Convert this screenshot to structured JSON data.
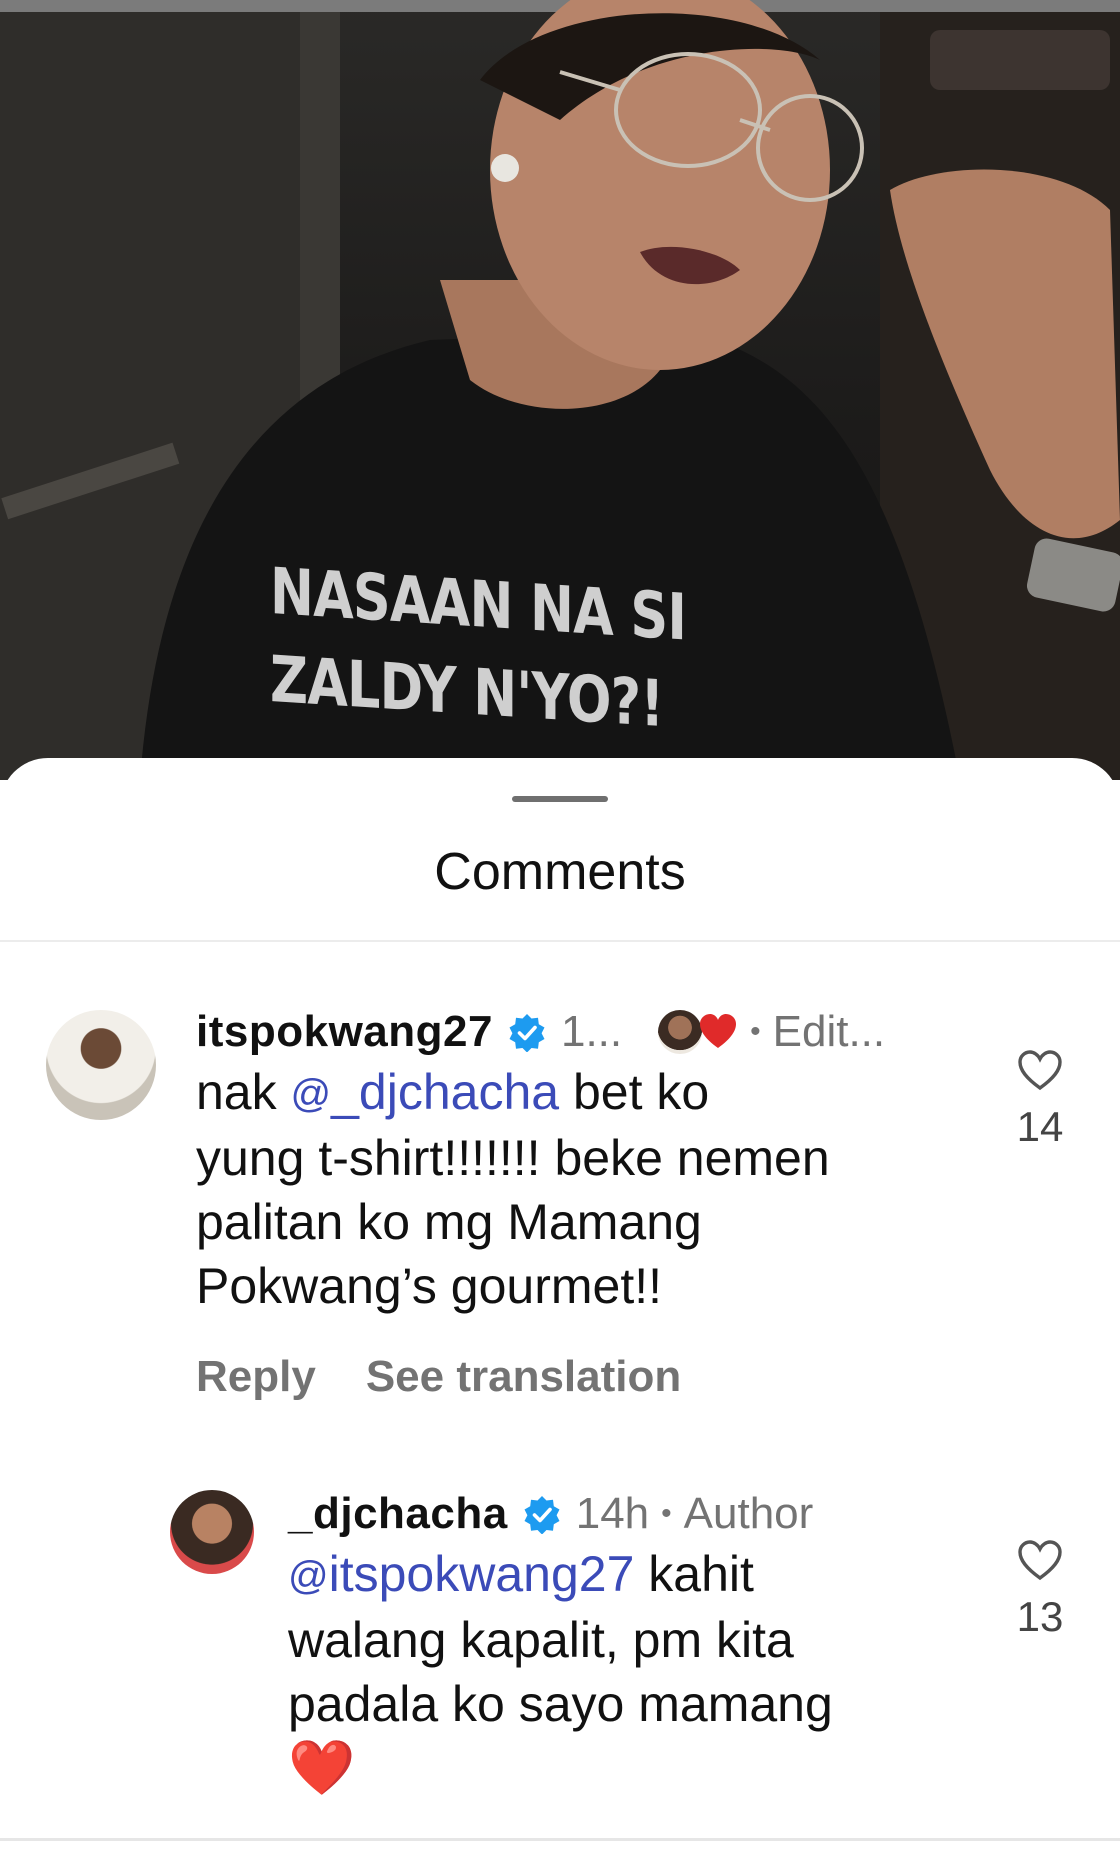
{
  "photo": {
    "shirt_line1": "NASAAN NA SI",
    "shirt_line2": "ZALDY N'YO?!"
  },
  "sheet": {
    "title": "Comments"
  },
  "comments": [
    {
      "username": "itspokwang27",
      "verified": true,
      "time": "1...",
      "author_liked": true,
      "edited": "Edit...",
      "mention": "_djchacha",
      "text_before_mention": "nak ",
      "text_after_mention": " bet ko\nyung t-shirt!!!!!!! beke nemen\npalitan ko mg Mamang\nPokwang’s gourmet!!",
      "actions": {
        "reply": "Reply",
        "see_translation": "See translation"
      },
      "likes": "14"
    },
    {
      "username": "_djchacha",
      "verified": true,
      "time": "14h",
      "badge": "Author",
      "mention": "itspokwang27",
      "text_after_mention": " kahit\nwalang kapalit, pm kita\npadala ko sayo mamang\n",
      "emoji": "❤️",
      "likes": "13"
    }
  ],
  "icons": {
    "verified": "verified-badge-icon",
    "like": "heart-outline-icon",
    "threads": "threads-icon",
    "author_liked": "red-heart-icon"
  },
  "colors": {
    "mention": "#3b4bb8",
    "verified": "#1d9bf0",
    "secondary_text": "#737373",
    "heart_red": "#e02a2a"
  }
}
